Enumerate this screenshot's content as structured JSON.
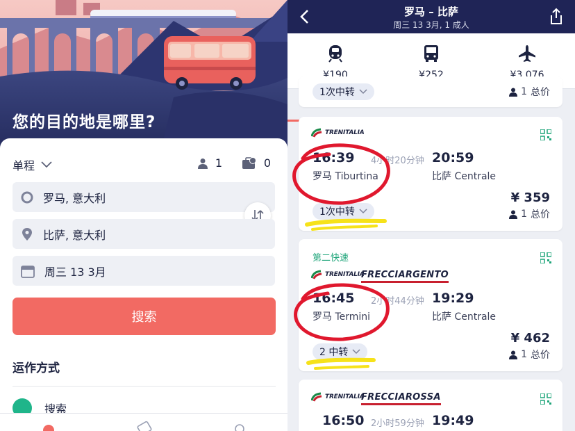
{
  "left": {
    "hero_title": "您的目的地是哪里?",
    "trip_type": "单程",
    "passengers": "1",
    "bags": "0",
    "origin": "罗马, 意大利",
    "destination": "比萨, 意大利",
    "date": "周三 13 3月",
    "search_label": "搜索",
    "section_title": "运作方式",
    "how_item": "搜索"
  },
  "right": {
    "route_title": "罗马 – 比萨",
    "route_subtitle": "周三 13 3月, 1 成人",
    "modes": [
      {
        "icon": "train-icon",
        "price": "¥190",
        "active": true
      },
      {
        "icon": "bus-icon",
        "price": "¥252",
        "active": false
      },
      {
        "icon": "plane-icon",
        "price": "¥3,076",
        "active": false
      }
    ],
    "partial_card": {
      "transfer": "1次中转",
      "pax": "1",
      "total": "总价"
    },
    "results": [
      {
        "tag": "",
        "operator": "TRENITALIA",
        "brand": "",
        "dep_time": "16:39",
        "duration": "4小时20分钟",
        "arr_time": "20:59",
        "dep_station": "罗马 Tiburtina",
        "arr_station": "比萨 Centrale",
        "price": "¥ 359",
        "pax": "1",
        "total": "总价",
        "transfer": "1次中转"
      },
      {
        "tag": "第二快速",
        "operator": "TRENITALIA",
        "brand": "FRECCIARGENTO",
        "dep_time": "16:45",
        "duration": "2小时44分钟",
        "arr_time": "19:29",
        "dep_station": "罗马 Termini",
        "arr_station": "比萨 Centrale",
        "price": "¥ 462",
        "pax": "1",
        "total": "总价",
        "transfer": "2 中转"
      },
      {
        "tag": "",
        "operator": "TRENITALIA",
        "brand": "FRECCIAROSSA",
        "dep_time": "16:50",
        "duration": "2小时59分钟",
        "arr_time": "19:49"
      }
    ]
  },
  "colors": {
    "navy": "#1f2456",
    "accent": "#f26a63",
    "green": "#1fa57a",
    "annotation_red": "#e0182e",
    "annotation_yellow": "#f6e21a"
  }
}
